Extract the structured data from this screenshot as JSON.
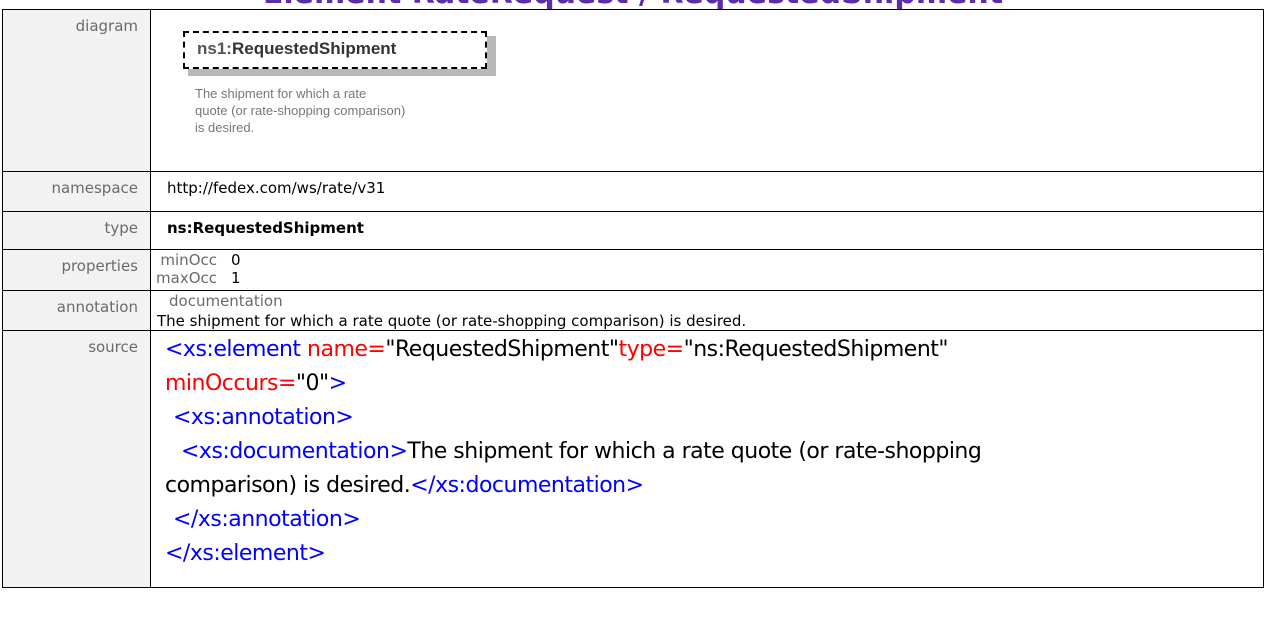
{
  "page_title": "Element RateRequest / RequestedShipment",
  "rows": {
    "diagram": {
      "label": "diagram",
      "element_prefix": "ns1:",
      "element_name": "RequestedShipment",
      "doc_line1": "The shipment for which a rate",
      "doc_line2": "quote (or rate-shopping comparison)",
      "doc_line3": "is desired."
    },
    "namespace": {
      "label": "namespace",
      "value": "http://fedex.com/ws/rate/v31"
    },
    "type": {
      "label": "type",
      "value": "ns:RequestedShipment"
    },
    "properties": {
      "label": "properties",
      "items": [
        {
          "key": "minOcc",
          "value": "0"
        },
        {
          "key": "maxOcc",
          "value": "1"
        }
      ]
    },
    "annotation": {
      "label": "annotation",
      "key": "documentation",
      "text": "The shipment for which a rate quote (or rate-shopping comparison) is desired."
    },
    "source": {
      "label": "source",
      "l1_tag": "<xs:element",
      "l1_attr1": " name=",
      "l1_val1": "\"RequestedShipment\"",
      "l1_attr2": "type=",
      "l1_val2": "\"ns:RequestedShipment\"",
      "l2_attr": "minOccurs=",
      "l2_val": "\"0\"",
      "l2_close": ">",
      "l3_tag": "<xs:annotation>",
      "l4_tag": "<xs:documentation>",
      "l4_text": "The shipment for which a rate quote (or rate-shopping",
      "l5_text": "comparison) is desired.",
      "l5_close": "</xs:documentation>",
      "l6_tag": "</xs:annotation>",
      "l7_tag": "</xs:element>"
    }
  },
  "colors": {
    "tag": "#0000ff",
    "attr": "#ff0000",
    "title": "#5b2da8",
    "label_bg": "#f2f2f2"
  }
}
